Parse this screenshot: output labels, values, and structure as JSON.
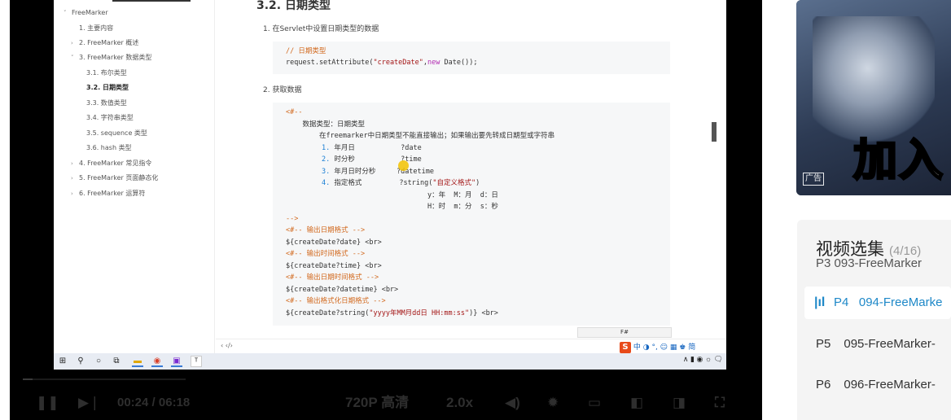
{
  "doc": {
    "toc": {
      "root": "FreeMarker",
      "items": [
        {
          "label": "1. 主要内容",
          "caret": ""
        },
        {
          "label": "2. FreeMarker 概述",
          "caret": "›"
        },
        {
          "label": "3. FreeMarker 数据类型",
          "caret": "˅"
        },
        {
          "label": "3.1. 布尔类型",
          "caret": ""
        },
        {
          "label": "3.2. 日期类型",
          "caret": "",
          "active": true
        },
        {
          "label": "3.3. 数值类型",
          "caret": ""
        },
        {
          "label": "3.4. 字符串类型",
          "caret": ""
        },
        {
          "label": "3.5. sequence 类型",
          "caret": ""
        },
        {
          "label": "3.6. hash 类型",
          "caret": ""
        },
        {
          "label": "4. FreeMarker 常见指令",
          "caret": "›"
        },
        {
          "label": "5. FreeMarker 页面静态化",
          "caret": "›"
        },
        {
          "label": "6. FreeMarker 运算符",
          "caret": "›"
        }
      ]
    },
    "heading": "3.2. 日期类型",
    "step1": "1. 在Servlet中设置日期类型的数据",
    "code1": {
      "comment": "// 日期类型",
      "line_a": "request.setAttribute(",
      "line_str": "\"createDate\"",
      "line_kw": "new",
      "line_b": " Date());"
    },
    "step2": "2. 获取数据",
    "code2": {
      "l01": "<#--",
      "l02": "    数据类型：日期类型",
      "l03": "        在freemarker中日期类型不能直接输出；如果输出要先转成日期型或字符串",
      "l04_num": "1.",
      "l04_txt": " 年月日           ?date",
      "l05_num": "2.",
      "l05_txt": " 时分秒           ?time",
      "l06_num": "3.",
      "l06_txt": " 年月日时分秒     ?datetime",
      "l07_num": "4.",
      "l07_txt": " 指定格式         ?string(",
      "l07_str": "\"自定义格式\"",
      "l07_end": ")",
      "l08": "                                  y：年  M：月  d：日",
      "l09": "                                  H：时  m：分  s：秒",
      "l10": "-->",
      "l11": "<#-- 输出日期格式 -->",
      "l12": "${createDate?date} <br>",
      "l13": "<#-- 输出时间格式 -->",
      "l14": "${createDate?time} <br>",
      "l15": "<#-- 输出日期时间格式 -->",
      "l16": "${createDate?datetime} <br>",
      "l17": "<#-- 输出格式化日期格式 -->",
      "l18_a": "${createDate?string(",
      "l18_str": "\"yyyy年MM月dd日 HH:mm:ss\"",
      "l18_b": ")} <br>"
    },
    "footer_nav": "‹  ‹/›",
    "hash_box": "F#",
    "ime_text": "中 ◑ °, ☺ ▦ ♚ 简",
    "tray_text": "∧ ▮ ◉ ☼ 🗨"
  },
  "player": {
    "time_current": "00:24",
    "time_sep": "/",
    "time_total": "06:18",
    "quality": "720P 高清",
    "speed": "2.0x",
    "progress_fraction": 0.06
  },
  "ad": {
    "tag": "广告",
    "big_text": "加入"
  },
  "playlist": {
    "title": "视频选集",
    "count": "(4/16)",
    "cut_item": "P3   093-FreeMarker",
    "active_num": "P4",
    "active_label": "094-FreeMarke",
    "items": [
      {
        "num": "P5",
        "label": "095-FreeMarker-"
      },
      {
        "num": "P6",
        "label": "096-FreeMarker-"
      }
    ]
  },
  "colors": {
    "accent": "#1e88c8",
    "code_comment": "#d2691e",
    "code_string": "#a31515",
    "code_keyword": "#b22bb2"
  }
}
